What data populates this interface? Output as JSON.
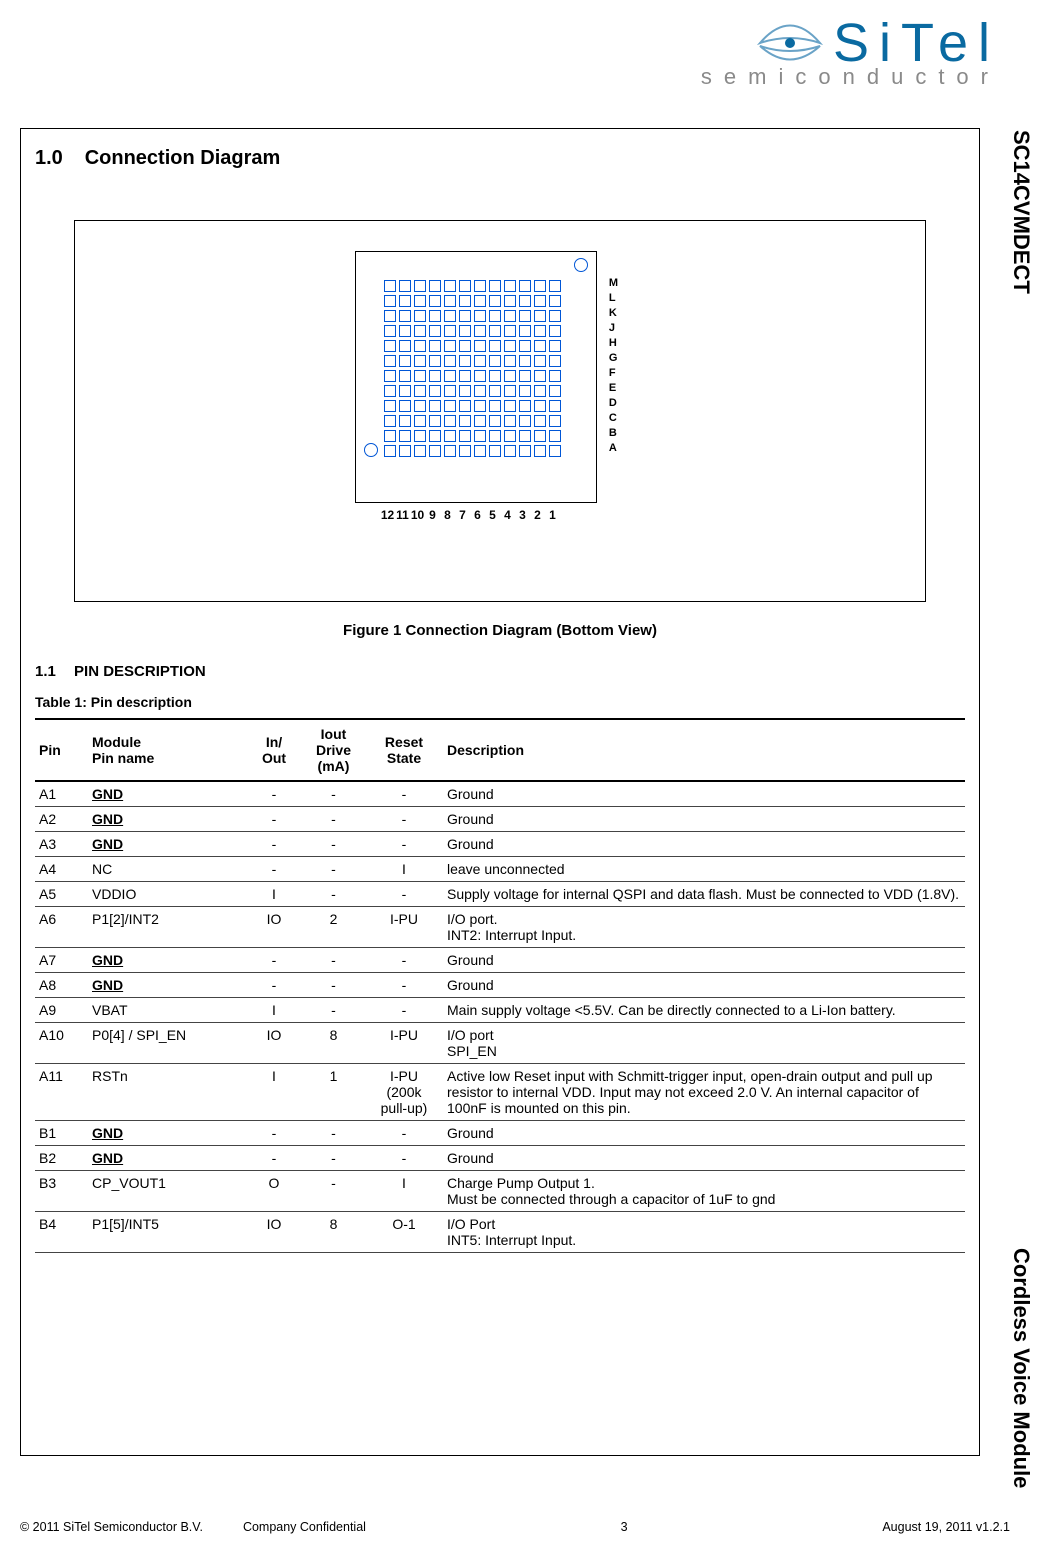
{
  "logo": {
    "company": "SiTel",
    "sub": "semiconductor"
  },
  "side": {
    "top": "SC14CVMDECT",
    "bottom": "Cordless Voice Module"
  },
  "section": {
    "num": "1.0",
    "title": "Connection Diagram"
  },
  "figure": {
    "caption": "Figure 1  Connection Diagram (Bottom View)",
    "rows": [
      "M",
      "L",
      "K",
      "J",
      "H",
      "G",
      "F",
      "E",
      "D",
      "C",
      "B",
      "A"
    ],
    "cols": [
      "12",
      "11",
      "10",
      "9",
      "8",
      "7",
      "6",
      "5",
      "4",
      "3",
      "2",
      "1"
    ]
  },
  "subsection": {
    "num": "1.1",
    "title": "PIN DESCRIPTION"
  },
  "table": {
    "title": "Table 1: Pin description",
    "headers": {
      "pin": "Pin",
      "name": "Module\nPin name",
      "io": "In/\nOut",
      "drive": "Iout\nDrive\n(mA)",
      "reset": "Reset\nState",
      "desc": "Description"
    },
    "rows": [
      {
        "pin": "A1",
        "name": "GND",
        "u": true,
        "io": "-",
        "drive": "-",
        "reset": "-",
        "desc": "Ground"
      },
      {
        "pin": "A2",
        "name": "GND",
        "u": true,
        "io": "-",
        "drive": "-",
        "reset": "-",
        "desc": "Ground"
      },
      {
        "pin": "A3",
        "name": "GND",
        "u": true,
        "io": "-",
        "drive": "-",
        "reset": "-",
        "desc": "Ground"
      },
      {
        "pin": "A4",
        "name": "NC",
        "u": false,
        "io": "-",
        "drive": "-",
        "reset": "I",
        "desc": "leave unconnected"
      },
      {
        "pin": "A5",
        "name": "VDDIO",
        "u": false,
        "io": "I",
        "drive": "-",
        "reset": "-",
        "desc": "Supply voltage for internal QSPI and data flash. Must be connected to VDD (1.8V)."
      },
      {
        "pin": "A6",
        "name": "P1[2]/INT2",
        "u": false,
        "io": "IO",
        "drive": "2",
        "reset": "I-PU",
        "desc": "I/O port.\nINT2: Interrupt Input."
      },
      {
        "pin": "A7",
        "name": "GND",
        "u": true,
        "io": "-",
        "drive": "-",
        "reset": "-",
        "desc": "Ground"
      },
      {
        "pin": "A8",
        "name": "GND",
        "u": true,
        "io": "-",
        "drive": "-",
        "reset": "-",
        "desc": "Ground"
      },
      {
        "pin": "A9",
        "name": "VBAT",
        "u": false,
        "io": "I",
        "drive": "-",
        "reset": "-",
        "desc": "Main supply voltage <5.5V. Can be directly connected to a Li-Ion battery."
      },
      {
        "pin": "A10",
        "name": "P0[4] / SPI_EN",
        "u": false,
        "io": "IO",
        "drive": "8",
        "reset": "I-PU",
        "desc": "I/O port\nSPI_EN"
      },
      {
        "pin": "A11",
        "name": "RSTn",
        "u": false,
        "io": "I",
        "drive": "1",
        "reset": "I-PU\n(200k\npull-up)",
        "desc": "Active low Reset input with Schmitt-trigger input, open-drain output and pull up resistor to internal VDD. Input may not exceed 2.0 V. An internal capacitor of 100nF is mounted on this pin."
      },
      {
        "pin": "B1",
        "name": "GND",
        "u": true,
        "io": "-",
        "drive": "-",
        "reset": "-",
        "desc": "Ground"
      },
      {
        "pin": "B2",
        "name": "GND",
        "u": true,
        "io": "-",
        "drive": "-",
        "reset": "-",
        "desc": "Ground"
      },
      {
        "pin": "B3",
        "name": "CP_VOUT1",
        "u": false,
        "io": "O",
        "drive": "-",
        "reset": "I",
        "desc": "Charge Pump Output 1.\nMust be connected through a capacitor of 1uF to gnd"
      },
      {
        "pin": "B4",
        "name": "P1[5]/INT5",
        "u": false,
        "io": "IO",
        "drive": "8",
        "reset": "O-1",
        "desc": "I/O Port\nINT5: Interrupt Input."
      }
    ]
  },
  "footer": {
    "copyright": "© 2011 SiTel Semiconductor B.V.",
    "confidential": "Company Confidential",
    "page": "3",
    "date": "August 19, 2011 v1.2.1"
  }
}
